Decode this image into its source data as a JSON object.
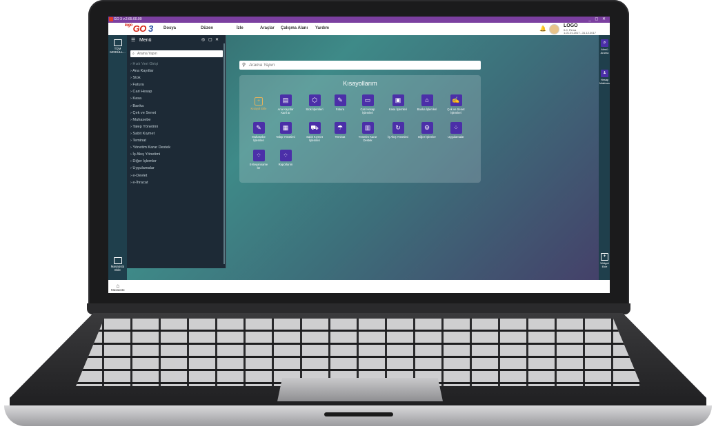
{
  "window": {
    "title": "GO 3 v.2.65.00.00",
    "controls": "_ ◻ ✕"
  },
  "brand": {
    "prefix": "logo",
    "name": "GO",
    "version": "3"
  },
  "menubar": [
    "Dosya",
    "Düzen",
    "İzle",
    "Araçlar",
    "Çalışma Alanı",
    "Yardım"
  ],
  "company": {
    "name": "LOGO",
    "line1": "0-0, Firma",
    "line2": "1-01.01.2017...31.12.2017"
  },
  "leftbar": {
    "modules_label": "TÜM MODÜLL...",
    "desktop_add_label": "Masaüstü Ekle"
  },
  "panel": {
    "title": "Menü",
    "search_placeholder": "Arama Yapın",
    "items": [
      "Hızlı Veri Girişi",
      "Ana Kayıtlar",
      "Stok",
      "Fatura",
      "Cari Hesap",
      "Kasa",
      "Banka",
      "Çek ve Senet",
      "Muhasebe",
      "Talep Yönetimi",
      "Sabit Kıymet",
      "Teminat",
      "Yönetim Karar Destek",
      "İş Akış Yönetimi",
      "Diğer İşlemler",
      "Uygulamalar",
      "e-Devlet",
      "e-İhracat"
    ]
  },
  "search": {
    "placeholder": "Arama Yapın"
  },
  "shortcuts": {
    "title": "Kısayollarım",
    "tiles": [
      {
        "label": "Kısayol Ekle",
        "icon": "plus-icon"
      },
      {
        "label": "Ana Kayıtlar Kartl ar",
        "icon": "cards-icon"
      },
      {
        "label": "Stok İşlemleri",
        "icon": "box-icon"
      },
      {
        "label": "Fatura",
        "icon": "invoice-icon"
      },
      {
        "label": "Cari Hesap İşlemleri",
        "icon": "account-icon"
      },
      {
        "label": "Kasa İşlemleri",
        "icon": "safe-icon"
      },
      {
        "label": "Banka İşlemleri",
        "icon": "bank-icon"
      },
      {
        "label": "Çek ve Senet İşlemleri",
        "icon": "check-icon"
      },
      {
        "label": "Muhasebe İşlemleri",
        "icon": "ledger-icon"
      },
      {
        "label": "Talep Yönetimi",
        "icon": "request-icon"
      },
      {
        "label": "Sabit Kıymet İşlemleri",
        "icon": "asset-icon"
      },
      {
        "label": "Teminat",
        "icon": "umbrella-icon"
      },
      {
        "label": "Yönetim Karar Destek",
        "icon": "chart-icon"
      },
      {
        "label": "İş Akış Yönetimi",
        "icon": "workflow-icon"
      },
      {
        "label": "Diğer İşlemler",
        "icon": "gears-icon"
      },
      {
        "label": "Uygulamalar",
        "icon": "apps-icon"
      },
      {
        "label": "E-Beyanname ler",
        "icon": "apps-icon"
      },
      {
        "label": "Raporlarım",
        "icon": "apps-icon"
      }
    ]
  },
  "rightbar": {
    "menu_search": "Menü Arama",
    "calculator": "Hesap Makinesi",
    "widget_add": "Widget Ekle"
  },
  "home": {
    "label": "Masaüstü"
  }
}
